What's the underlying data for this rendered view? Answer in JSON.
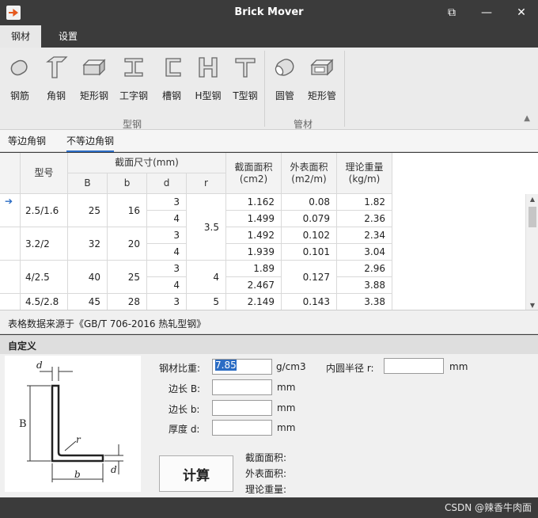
{
  "window": {
    "title": "Brick Mover",
    "restore_glyph": "⧉",
    "minimize_glyph": "—",
    "close_glyph": "✕"
  },
  "ribbon_tabs": [
    "钢材",
    "设置"
  ],
  "ribbon": {
    "groups": [
      "型钢",
      "管材"
    ],
    "buttons": [
      "钢筋",
      "角钢",
      "矩形钢",
      "工字钢",
      "槽钢",
      "H型钢",
      "T型钢",
      "圆管",
      "矩形管"
    ]
  },
  "sub_tabs": [
    "等边角钢",
    "不等边角钢"
  ],
  "table": {
    "headers": {
      "model": "型号",
      "section_size": "截面尺寸(mm)",
      "B": "B",
      "b": "b",
      "d": "d",
      "r": "r",
      "area": "截面面积\n(cm2)",
      "surface": "外表面积\n(m2/m)",
      "weight": "理论重量\n(kg/m)"
    },
    "models": [
      "2.5/1.6",
      "3.2/2",
      "4/2.5",
      "4.5/2.8"
    ],
    "B": [
      "25",
      "32",
      "40",
      "45"
    ],
    "b": [
      "16",
      "20",
      "25",
      "28"
    ],
    "d": [
      "3",
      "4",
      "3",
      "4",
      "3",
      "4",
      "3"
    ],
    "r": [
      "3.5",
      "4",
      "5"
    ],
    "area": [
      "1.162",
      "1.499",
      "1.492",
      "1.939",
      "1.89",
      "2.467",
      "2.149"
    ],
    "surface": [
      "0.08",
      "0.079",
      "0.102",
      "0.101",
      "0.127",
      "0.143"
    ],
    "weight": [
      "1.82",
      "2.36",
      "2.34",
      "3.04",
      "2.96",
      "3.88",
      "3.38"
    ]
  },
  "source_note": "表格数据来源于《GB/T 706-2016 热轧型钢》",
  "custom": {
    "title": "自定义",
    "density_label": "钢材比重:",
    "density_value": "7.85",
    "density_unit": "g/cm3",
    "inner_radius_label": "内圆半径 r:",
    "inner_radius_unit": "mm",
    "B_label": "边长 B:",
    "b_label": "边长 b:",
    "d_label": "厚度 d:",
    "mm": "mm",
    "calc_button": "计算",
    "area_label": "截面面积:",
    "surface_label": "外表面积:",
    "weight_label": "理论重量:",
    "diagram_labels": {
      "d_top": "d",
      "B": "B",
      "r": "r",
      "b": "b",
      "d_side": "d"
    }
  },
  "watermark": "CSDN @辣香牛肉面",
  "colors": {
    "titlebar": "#3b3b3b",
    "accent": "#2b6cc4",
    "ribbon": "#ebebeb"
  }
}
